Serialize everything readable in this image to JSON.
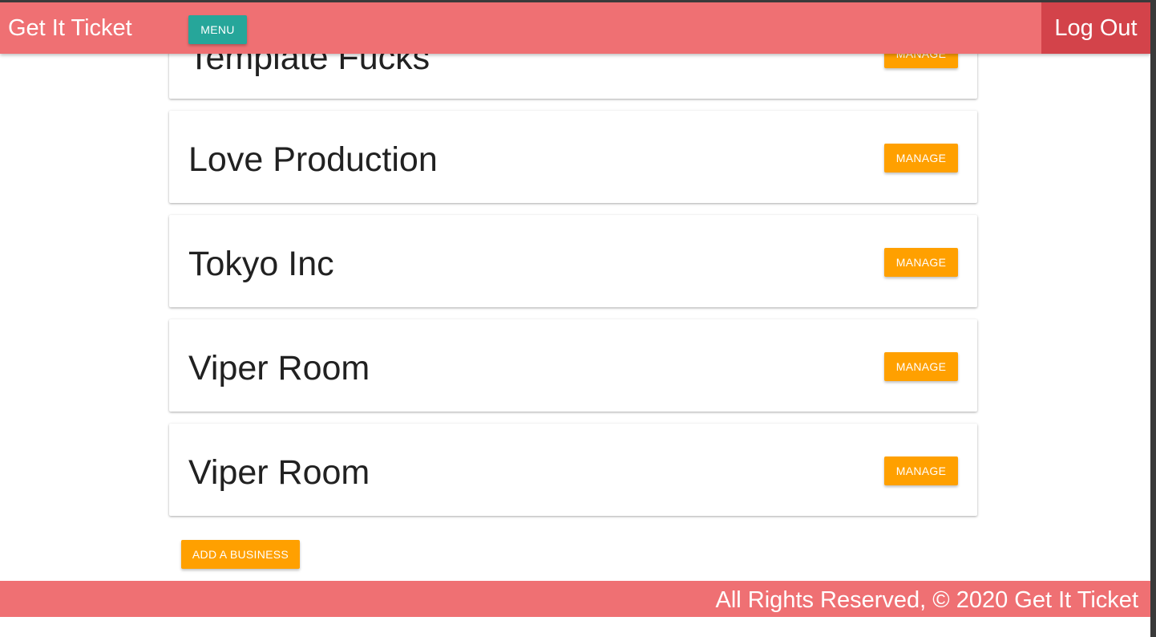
{
  "header": {
    "brand": "Get It Ticket",
    "menu_label": "MENU",
    "logout_label": "Log Out"
  },
  "businesses": [
    {
      "name": "Template Fucks",
      "action_label": "MANAGE"
    },
    {
      "name": "Love Production",
      "action_label": "MANAGE"
    },
    {
      "name": "Tokyo Inc",
      "action_label": "MANAGE"
    },
    {
      "name": "Viper Room",
      "action_label": "MANAGE"
    },
    {
      "name": "Viper Room",
      "action_label": "MANAGE"
    }
  ],
  "add_business_label": "ADD A BUSINESS",
  "footer": {
    "text": "All Rights Reserved, © 2020 Get It Ticket"
  },
  "colors": {
    "header_bg": "#ef7073",
    "menu_button": "#26a69a",
    "logout_button": "#d3434a",
    "action_button": "#ffa000"
  }
}
